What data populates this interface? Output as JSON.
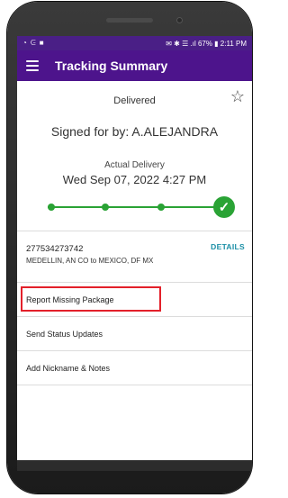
{
  "statusbar": {
    "left_icons": [
      "◔",
      "ᕮ",
      "■"
    ],
    "right_text": "✉ ✱ ☰ .ıl 67% ▮ 2:11 PM"
  },
  "header": {
    "menu_icon": "menu-icon",
    "title": "Tracking Summary"
  },
  "summary": {
    "status": "Delivered",
    "star_icon": "star-outline-icon",
    "signed_for": "Signed for by: A.ALEJANDRA",
    "delivery_label": "Actual Delivery",
    "delivery_date": "Wed Sep 07, 2022 4:27 PM",
    "progress_steps": 4,
    "completed_steps": 4,
    "accent_color": "#2aa335"
  },
  "shipment": {
    "tracking_number": "277534273742",
    "route": "MEDELLIN, AN CO to MEXICO, DF MX",
    "details_label": "DETAILS"
  },
  "actions": [
    {
      "label": "Report Missing Package",
      "highlighted": true
    },
    {
      "label": "Send Status Updates",
      "highlighted": false
    },
    {
      "label": "Add Nickname & Notes",
      "highlighted": false
    }
  ],
  "colors": {
    "brand_purple": "#4d148c",
    "link_teal": "#1b8fa6",
    "highlight_red": "#e3202a"
  }
}
